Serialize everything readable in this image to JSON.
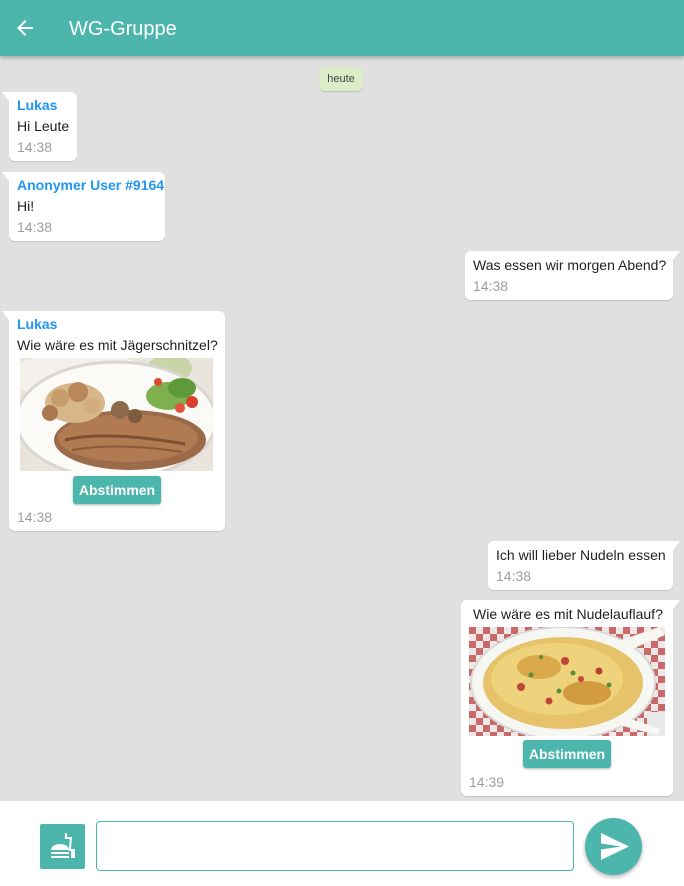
{
  "appbar": {
    "title": "WG-Gruppe",
    "back_icon": "arrow-left-icon"
  },
  "colors": {
    "primary": "#4db6ac",
    "sender": "#2196f3",
    "date_chip": "#dcedc8",
    "background": "#e0e0e0"
  },
  "chat": {
    "date_label": "heute",
    "messages": [
      {
        "sender": "Lukas",
        "text": "Hi Leute",
        "time": "14:38"
      },
      {
        "sender": "Anonymer User #9164",
        "text": "Hi!",
        "time": "14:38"
      },
      {
        "text": "Was essen wir morgen Abend?",
        "time": "14:38"
      },
      {
        "sender": "Lukas",
        "text": "Wie wäre es mit Jägerschnitzel?",
        "button": "Abstimmen",
        "time": "14:38"
      },
      {
        "text": "Ich will lieber Nudeln essen",
        "time": "14:38"
      },
      {
        "text": "Wie wäre es mit Nudelauflauf?",
        "button": "Abstimmen",
        "time": "14:39"
      }
    ]
  },
  "composer": {
    "value": "",
    "meal_icon": "fastfood-icon",
    "send_icon": "send-icon"
  }
}
